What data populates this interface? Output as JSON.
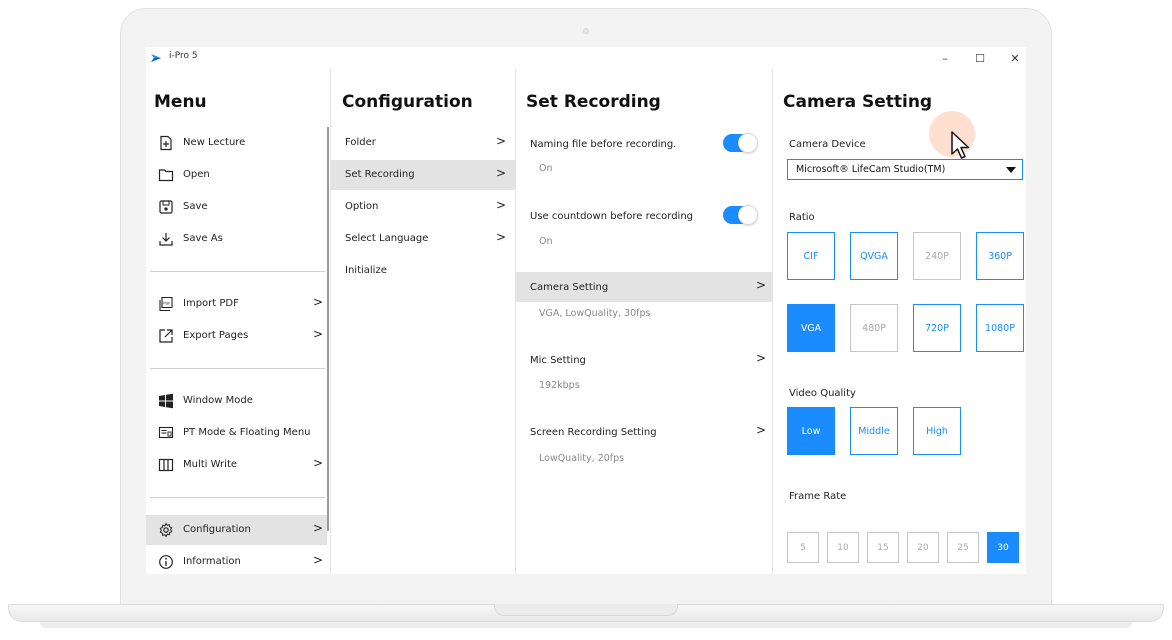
{
  "window": {
    "title": "i-Pro 5",
    "minimize_glyph": "–",
    "maximize_glyph": "☐",
    "close_glyph": "✕"
  },
  "menu": {
    "title": "Menu",
    "items": [
      {
        "label": "New Lecture",
        "icon": "new-file-icon"
      },
      {
        "label": "Open",
        "icon": "folder-icon"
      },
      {
        "label": "Save",
        "icon": "save-icon"
      },
      {
        "label": "Save As",
        "icon": "download-icon"
      },
      {
        "label": "Import PDF",
        "icon": "pdf-icon"
      },
      {
        "label": "Export Pages",
        "icon": "export-icon"
      },
      {
        "label": "Window Mode",
        "icon": "windows-icon"
      },
      {
        "label": "PT Mode & Floating Menu",
        "icon": "pt-mode-icon"
      },
      {
        "label": "Multi Write",
        "icon": "columns-icon"
      },
      {
        "label": "Configuration",
        "icon": "gear-icon"
      },
      {
        "label": "Information",
        "icon": "info-icon"
      }
    ]
  },
  "configuration": {
    "title": "Configuration",
    "items": [
      {
        "label": "Folder"
      },
      {
        "label": "Set Recording"
      },
      {
        "label": "Option"
      },
      {
        "label": "Select Language"
      },
      {
        "label": "Initialize"
      }
    ]
  },
  "recording": {
    "title": "Set Recording",
    "naming": {
      "label": "Naming file before recording.",
      "value": "On"
    },
    "countdown": {
      "label": "Use countdown before recording",
      "value": "On"
    },
    "camera": {
      "label": "Camera Setting",
      "value": "VGA, LowQuality, 30fps"
    },
    "mic": {
      "label": "Mic Setting",
      "value": "192kbps"
    },
    "screen": {
      "label": "Screen Recording Setting",
      "value": "LowQuality, 20fps"
    }
  },
  "camera": {
    "title": "Camera Setting",
    "device_label": "Camera Device",
    "device_value": "Microsoft® LifeCam Studio(TM)",
    "ratio_label": "Ratio",
    "ratio_options": [
      "CIF",
      "QVGA",
      "240P",
      "360P",
      "VGA",
      "480P",
      "720P",
      "1080P"
    ],
    "quality_label": "Video Quality",
    "quality_options": [
      "Low",
      "Middle",
      "High"
    ],
    "framerate_label": "Frame Rate",
    "framerate_options": [
      "5",
      "10",
      "15",
      "20",
      "25",
      "30"
    ]
  },
  "colors": {
    "accent": "#1a8cff",
    "selected_row": "#e3e3e3",
    "disabled": "#a9a9a9"
  }
}
